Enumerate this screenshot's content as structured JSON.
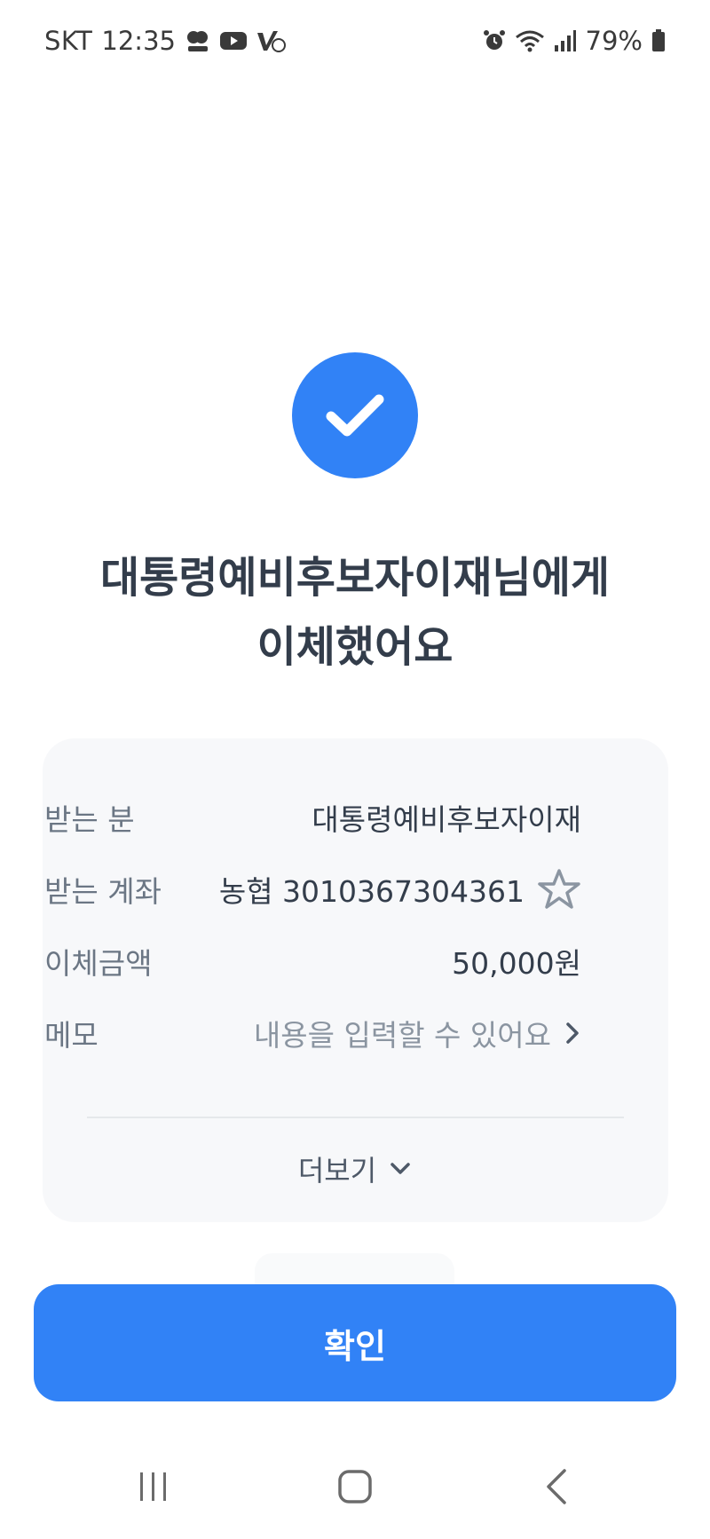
{
  "status_bar": {
    "carrier": "SKT",
    "time": "12:35",
    "battery_percent": "79%",
    "icons_left": [
      "won-app-icon",
      "youtube-icon",
      "vimeo-icon"
    ],
    "icons_right": [
      "alarm-icon",
      "wifi-icon",
      "signal-icon",
      "battery-icon"
    ]
  },
  "result": {
    "title_line1": "대통령예비후보자이재님에게",
    "title_line2": "이체했어요",
    "icon": "check-icon",
    "accent_color": "#3182f6"
  },
  "details": {
    "recipient_label": "받는 분",
    "recipient_value": "대통령예비후보자이재",
    "account_label": "받는 계좌",
    "account_value": "농협 3010367304361",
    "amount_label": "이체금액",
    "amount_value": "50,000원",
    "memo_label": "메모",
    "memo_placeholder": "내용을 입력할 수 있어요",
    "more_label": "더보기"
  },
  "actions": {
    "confirm_label": "확인"
  }
}
